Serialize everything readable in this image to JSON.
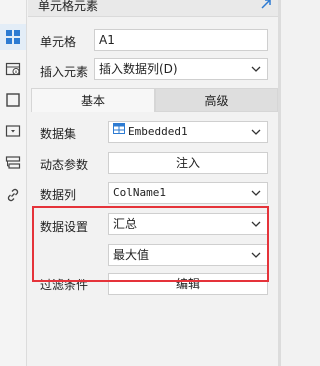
{
  "panel": {
    "title": "单元格元素"
  },
  "form": {
    "cell_label": "单元格",
    "cell_value": "A1",
    "insert_label": "插入元素",
    "insert_value": "插入数据列(D)"
  },
  "tabs": {
    "basic": "基本",
    "advanced": "高级"
  },
  "basic": {
    "dataset_label": "数据集",
    "dataset_value": "Embedded1",
    "dynamic_param_label": "动态参数",
    "inject_button": "注入",
    "column_label": "数据列",
    "column_value": "ColName1",
    "data_setting_label": "数据设置",
    "data_setting_value": "汇总",
    "aggregate_value": "最大值",
    "filter_label": "过滤条件",
    "edit_button": "编辑"
  },
  "colors": {
    "accent": "#2d7bd2",
    "highlight": "#e5333a"
  },
  "icons": {
    "strip": [
      "cell-element-icon",
      "cell-attribute-icon",
      "border-icon",
      "widget-icon",
      "condition-attribute-icon",
      "hyperlink-icon"
    ],
    "expand": "expand-arrow-icon",
    "dataset": "dataset-table-icon"
  }
}
